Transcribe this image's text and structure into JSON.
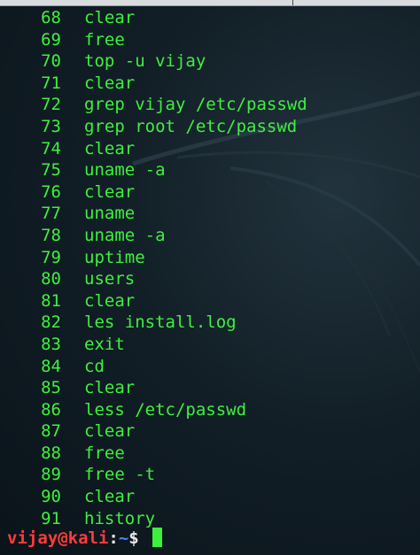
{
  "history": [
    {
      "num": "68",
      "cmd": "clear"
    },
    {
      "num": "69",
      "cmd": "free"
    },
    {
      "num": "70",
      "cmd": "top -u vijay"
    },
    {
      "num": "71",
      "cmd": "clear"
    },
    {
      "num": "72",
      "cmd": "grep vijay /etc/passwd"
    },
    {
      "num": "73",
      "cmd": "grep root /etc/passwd"
    },
    {
      "num": "74",
      "cmd": "clear"
    },
    {
      "num": "75",
      "cmd": "uname -a"
    },
    {
      "num": "76",
      "cmd": "clear"
    },
    {
      "num": "77",
      "cmd": "uname"
    },
    {
      "num": "78",
      "cmd": "uname -a"
    },
    {
      "num": "79",
      "cmd": "uptime"
    },
    {
      "num": "80",
      "cmd": "users"
    },
    {
      "num": "81",
      "cmd": "clear"
    },
    {
      "num": "82",
      "cmd": "les install.log"
    },
    {
      "num": "83",
      "cmd": "exit"
    },
    {
      "num": "84",
      "cmd": "cd"
    },
    {
      "num": "85",
      "cmd": "clear"
    },
    {
      "num": "86",
      "cmd": "less /etc/passwd"
    },
    {
      "num": "87",
      "cmd": "clear"
    },
    {
      "num": "88",
      "cmd": "free"
    },
    {
      "num": "89",
      "cmd": "free -t"
    },
    {
      "num": "90",
      "cmd": "clear"
    },
    {
      "num": "91",
      "cmd": "history"
    }
  ],
  "prompt": {
    "user_host": "vijay@kali",
    "separator": ":",
    "path": "~",
    "symbol": "$ "
  },
  "colors": {
    "output_text": "#3ef03e",
    "prompt_user": "#ff3b3b",
    "prompt_path": "#4f7dff",
    "background": "#0d1a22"
  }
}
